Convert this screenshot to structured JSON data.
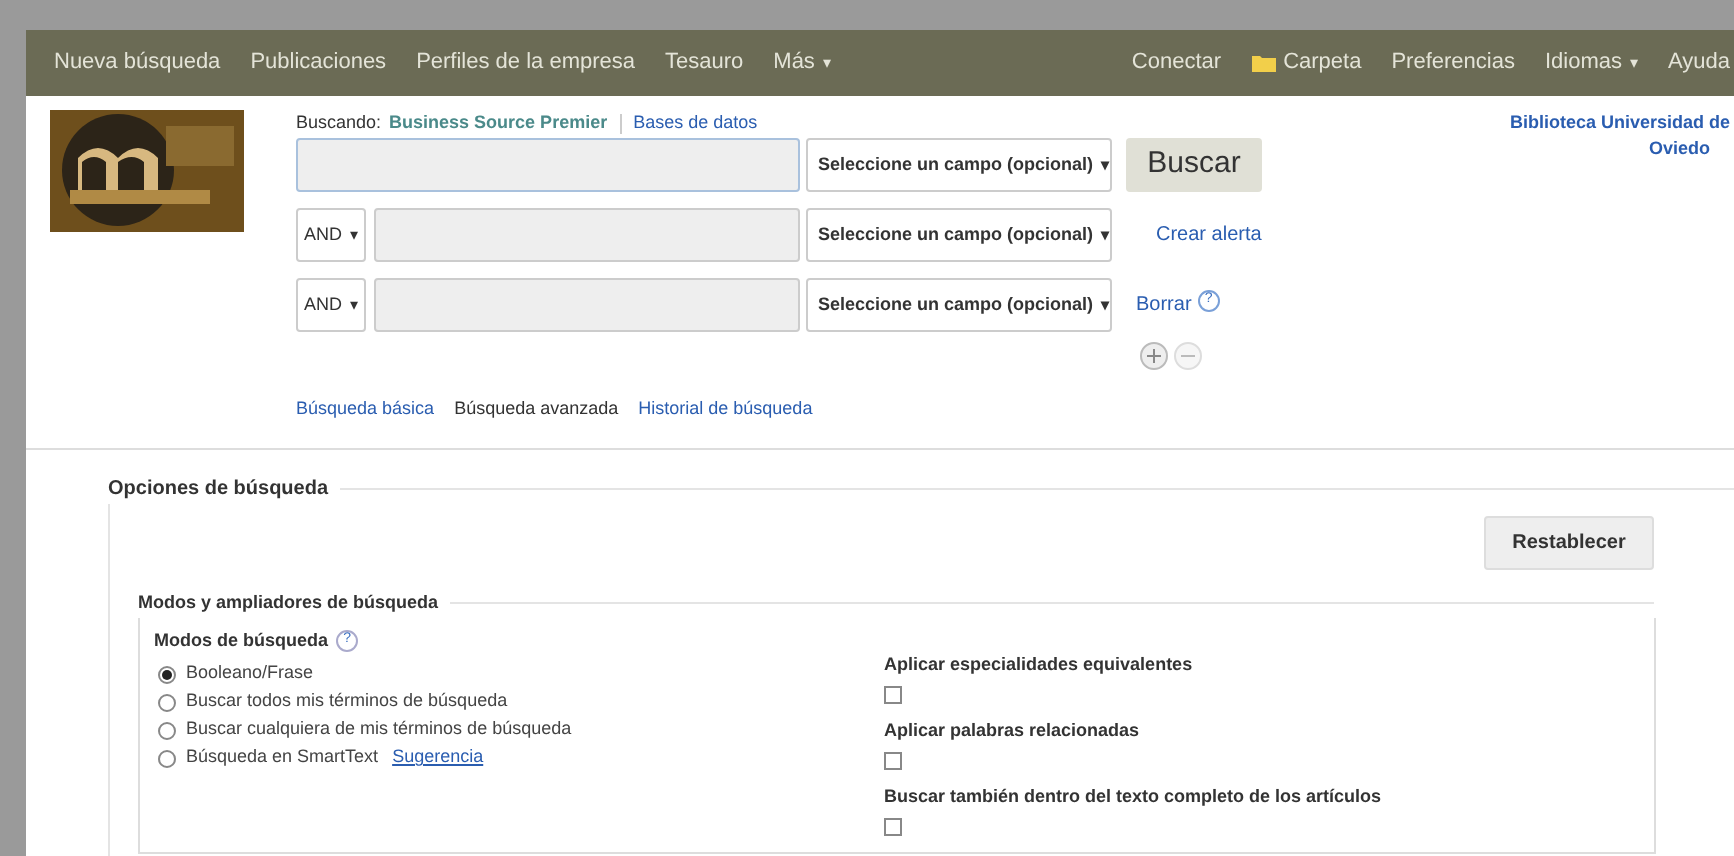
{
  "nav": {
    "left": [
      {
        "label": "Nueva búsqueda"
      },
      {
        "label": "Publicaciones"
      },
      {
        "label": "Perfiles de la empresa"
      },
      {
        "label": "Tesauro"
      },
      {
        "label": "Más",
        "caret": "▾"
      }
    ],
    "right": [
      {
        "label": "Conectar"
      },
      {
        "label": "Carpeta",
        "kind": "folder"
      },
      {
        "label": "Preferencias"
      },
      {
        "label": "Idiomas",
        "caret": "▾"
      },
      {
        "label": "Ayuda"
      }
    ]
  },
  "searching": {
    "label": "Buscando:",
    "database": "Business Source Premier",
    "link": "Bases de datos"
  },
  "rows": [
    {
      "field": "Seleccione un campo (opcional)",
      "caret": "▾"
    },
    {
      "operator": "AND",
      "caret": "▾",
      "field": "Seleccione un campo (opcional)"
    },
    {
      "operator": "AND",
      "caret": "▾",
      "field": "Seleccione un campo (opcional)"
    }
  ],
  "search_button": "Buscar",
  "create_alert": "Crear alerta",
  "clear": "Borrar",
  "help_mark": "?",
  "library": [
    "Biblioteca Universidad de",
    "Oviedo"
  ],
  "search_links": [
    {
      "label": "Búsqueda básica",
      "selected": false
    },
    {
      "label": "Búsqueda avanzada",
      "selected": true
    },
    {
      "label": "Historial de búsqueda",
      "selected": false
    }
  ],
  "options": {
    "title": "Opciones de búsqueda",
    "reset": "Restablecer",
    "group": "Modos y ampliadores de búsqueda",
    "modes_title": "Modos de búsqueda",
    "help_mark": "?",
    "modes": [
      {
        "label": "Booleano/Frase",
        "selected": true
      },
      {
        "label": "Buscar todos mis términos de búsqueda",
        "selected": false
      },
      {
        "label": "Buscar cualquiera de mis términos de búsqueda",
        "selected": false
      },
      {
        "label": "Búsqueda en SmartText",
        "selected": false,
        "link": "Sugerencia"
      }
    ],
    "expanders": [
      {
        "label": "Aplicar especialidades equivalentes",
        "checked": false
      },
      {
        "label": "Aplicar palabras relacionadas",
        "checked": false
      },
      {
        "label": "Buscar también dentro del texto completo de los artículos",
        "checked": false
      }
    ]
  }
}
